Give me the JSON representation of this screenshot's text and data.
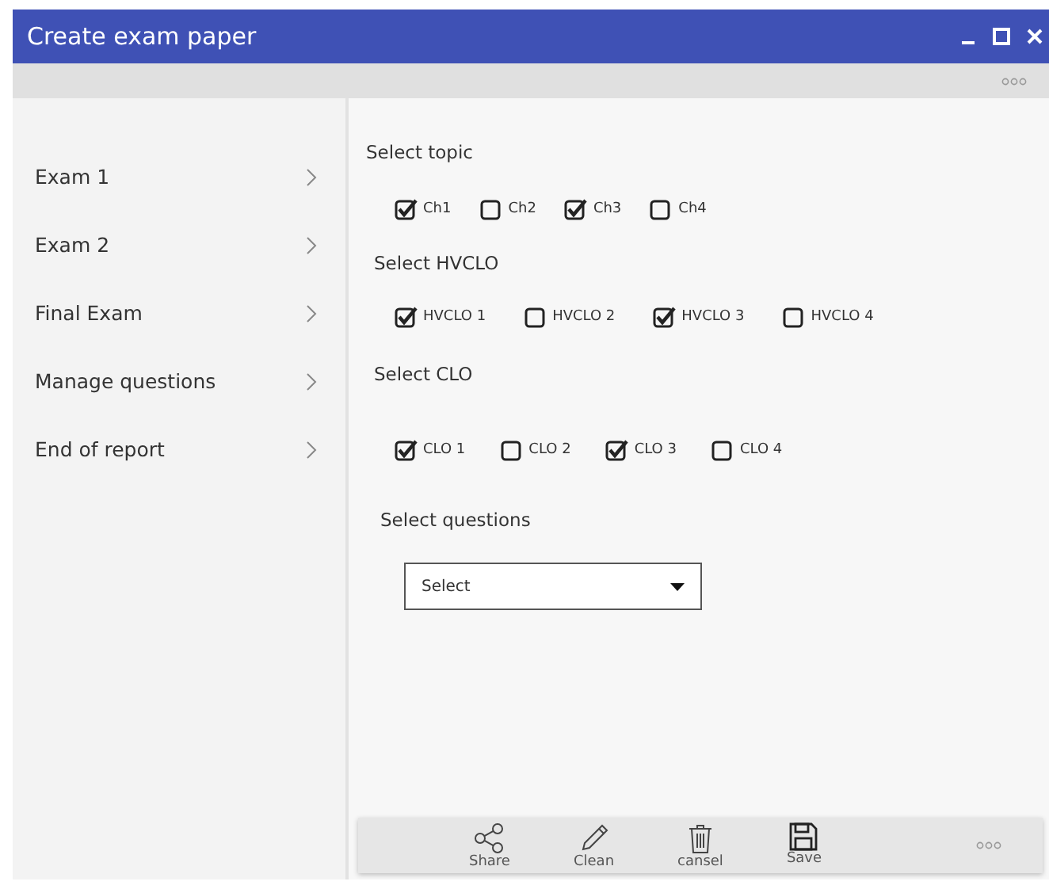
{
  "window": {
    "title": "Create exam paper"
  },
  "sidebar": {
    "items": [
      {
        "label": "Exam 1"
      },
      {
        "label": "Exam 2"
      },
      {
        "label": "Final Exam"
      },
      {
        "label": "Manage questions"
      },
      {
        "label": "End of report"
      }
    ]
  },
  "groups": [
    {
      "label": "Select topic",
      "options": [
        {
          "label": "Ch1",
          "checked": true
        },
        {
          "label": "Ch2",
          "checked": false
        },
        {
          "label": "Ch3",
          "checked": true
        },
        {
          "label": "Ch4",
          "checked": false
        }
      ]
    },
    {
      "label": "Select  HVCLO",
      "options": [
        {
          "label": "HVCLO 1",
          "checked": true
        },
        {
          "label": "HVCLO 2",
          "checked": false
        },
        {
          "label": "HVCLO 3",
          "checked": true
        },
        {
          "label": "HVCLO 4",
          "checked": false
        }
      ]
    },
    {
      "label": "Select CLO",
      "options": [
        {
          "label": "CLO 1",
          "checked": true
        },
        {
          "label": "CLO 2",
          "checked": false
        },
        {
          "label": "CLO 3",
          "checked": true
        },
        {
          "label": "CLO 4",
          "checked": false
        }
      ]
    }
  ],
  "questions": {
    "label": "Select questions",
    "dropdown": "Select"
  },
  "toolbar": [
    {
      "kind": "share",
      "label": "Share"
    },
    {
      "kind": "pen",
      "label": "Clean"
    },
    {
      "kind": "trash",
      "label": "cansel"
    },
    {
      "kind": "save",
      "label": "Save"
    }
  ]
}
